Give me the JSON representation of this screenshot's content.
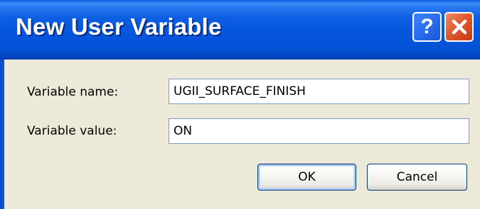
{
  "window": {
    "title": "New User Variable"
  },
  "titlebar": {
    "help_icon": "question-mark-icon",
    "help_glyph": "?",
    "close_icon": "close-x-icon"
  },
  "form": {
    "name_label": "Variable name:",
    "name_value": "UGII_SURFACE_FINISH",
    "value_label": "Variable value:",
    "value_value": "ON"
  },
  "buttons": {
    "ok_label": "OK",
    "cancel_label": "Cancel"
  },
  "colors": {
    "titlebar": "#0656de",
    "dialog_background": "#ece9d8",
    "close_button": "#e05a30",
    "field_border": "#7f9db9"
  }
}
